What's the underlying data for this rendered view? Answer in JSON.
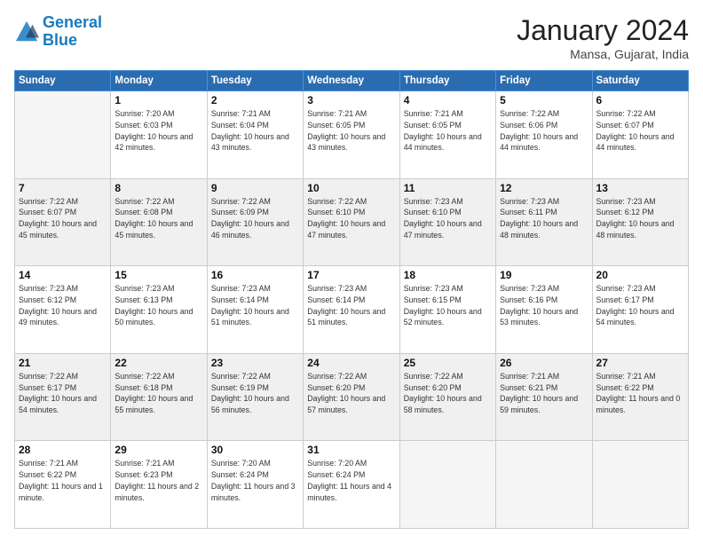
{
  "logo": {
    "line1": "General",
    "line2": "Blue"
  },
  "title": "January 2024",
  "location": "Mansa, Gujarat, India",
  "weekdays": [
    "Sunday",
    "Monday",
    "Tuesday",
    "Wednesday",
    "Thursday",
    "Friday",
    "Saturday"
  ],
  "weeks": [
    [
      {
        "day": "",
        "empty": true
      },
      {
        "day": "1",
        "sunrise": "7:20 AM",
        "sunset": "6:03 PM",
        "daylight": "10 hours and 42 minutes."
      },
      {
        "day": "2",
        "sunrise": "7:21 AM",
        "sunset": "6:04 PM",
        "daylight": "10 hours and 43 minutes."
      },
      {
        "day": "3",
        "sunrise": "7:21 AM",
        "sunset": "6:05 PM",
        "daylight": "10 hours and 43 minutes."
      },
      {
        "day": "4",
        "sunrise": "7:21 AM",
        "sunset": "6:05 PM",
        "daylight": "10 hours and 44 minutes."
      },
      {
        "day": "5",
        "sunrise": "7:22 AM",
        "sunset": "6:06 PM",
        "daylight": "10 hours and 44 minutes."
      },
      {
        "day": "6",
        "sunrise": "7:22 AM",
        "sunset": "6:07 PM",
        "daylight": "10 hours and 44 minutes."
      }
    ],
    [
      {
        "day": "7",
        "sunrise": "7:22 AM",
        "sunset": "6:07 PM",
        "daylight": "10 hours and 45 minutes."
      },
      {
        "day": "8",
        "sunrise": "7:22 AM",
        "sunset": "6:08 PM",
        "daylight": "10 hours and 45 minutes."
      },
      {
        "day": "9",
        "sunrise": "7:22 AM",
        "sunset": "6:09 PM",
        "daylight": "10 hours and 46 minutes."
      },
      {
        "day": "10",
        "sunrise": "7:22 AM",
        "sunset": "6:10 PM",
        "daylight": "10 hours and 47 minutes."
      },
      {
        "day": "11",
        "sunrise": "7:23 AM",
        "sunset": "6:10 PM",
        "daylight": "10 hours and 47 minutes."
      },
      {
        "day": "12",
        "sunrise": "7:23 AM",
        "sunset": "6:11 PM",
        "daylight": "10 hours and 48 minutes."
      },
      {
        "day": "13",
        "sunrise": "7:23 AM",
        "sunset": "6:12 PM",
        "daylight": "10 hours and 48 minutes."
      }
    ],
    [
      {
        "day": "14",
        "sunrise": "7:23 AM",
        "sunset": "6:12 PM",
        "daylight": "10 hours and 49 minutes."
      },
      {
        "day": "15",
        "sunrise": "7:23 AM",
        "sunset": "6:13 PM",
        "daylight": "10 hours and 50 minutes."
      },
      {
        "day": "16",
        "sunrise": "7:23 AM",
        "sunset": "6:14 PM",
        "daylight": "10 hours and 51 minutes."
      },
      {
        "day": "17",
        "sunrise": "7:23 AM",
        "sunset": "6:14 PM",
        "daylight": "10 hours and 51 minutes."
      },
      {
        "day": "18",
        "sunrise": "7:23 AM",
        "sunset": "6:15 PM",
        "daylight": "10 hours and 52 minutes."
      },
      {
        "day": "19",
        "sunrise": "7:23 AM",
        "sunset": "6:16 PM",
        "daylight": "10 hours and 53 minutes."
      },
      {
        "day": "20",
        "sunrise": "7:23 AM",
        "sunset": "6:17 PM",
        "daylight": "10 hours and 54 minutes."
      }
    ],
    [
      {
        "day": "21",
        "sunrise": "7:22 AM",
        "sunset": "6:17 PM",
        "daylight": "10 hours and 54 minutes."
      },
      {
        "day": "22",
        "sunrise": "7:22 AM",
        "sunset": "6:18 PM",
        "daylight": "10 hours and 55 minutes."
      },
      {
        "day": "23",
        "sunrise": "7:22 AM",
        "sunset": "6:19 PM",
        "daylight": "10 hours and 56 minutes."
      },
      {
        "day": "24",
        "sunrise": "7:22 AM",
        "sunset": "6:20 PM",
        "daylight": "10 hours and 57 minutes."
      },
      {
        "day": "25",
        "sunrise": "7:22 AM",
        "sunset": "6:20 PM",
        "daylight": "10 hours and 58 minutes."
      },
      {
        "day": "26",
        "sunrise": "7:21 AM",
        "sunset": "6:21 PM",
        "daylight": "10 hours and 59 minutes."
      },
      {
        "day": "27",
        "sunrise": "7:21 AM",
        "sunset": "6:22 PM",
        "daylight": "11 hours and 0 minutes."
      }
    ],
    [
      {
        "day": "28",
        "sunrise": "7:21 AM",
        "sunset": "6:22 PM",
        "daylight": "11 hours and 1 minute."
      },
      {
        "day": "29",
        "sunrise": "7:21 AM",
        "sunset": "6:23 PM",
        "daylight": "11 hours and 2 minutes."
      },
      {
        "day": "30",
        "sunrise": "7:20 AM",
        "sunset": "6:24 PM",
        "daylight": "11 hours and 3 minutes."
      },
      {
        "day": "31",
        "sunrise": "7:20 AM",
        "sunset": "6:24 PM",
        "daylight": "11 hours and 4 minutes."
      },
      {
        "day": "",
        "empty": true
      },
      {
        "day": "",
        "empty": true
      },
      {
        "day": "",
        "empty": true
      }
    ]
  ]
}
